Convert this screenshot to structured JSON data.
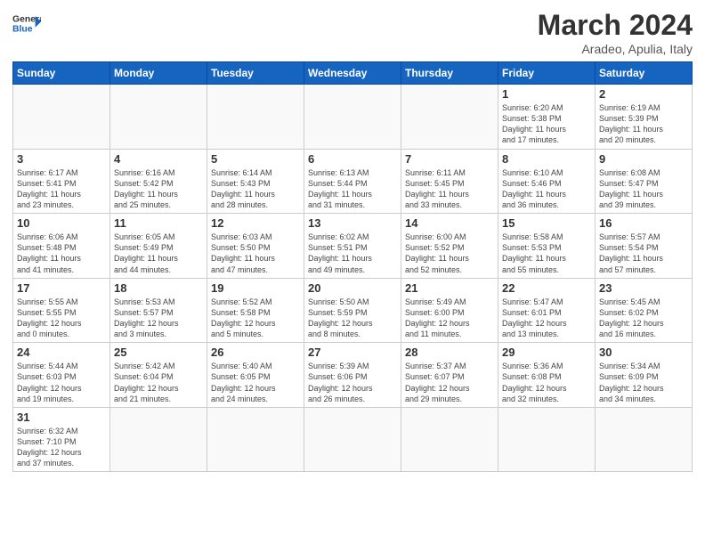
{
  "header": {
    "logo_general": "General",
    "logo_blue": "Blue",
    "title": "March 2024",
    "subtitle": "Aradeo, Apulia, Italy"
  },
  "days_of_week": [
    "Sunday",
    "Monday",
    "Tuesday",
    "Wednesday",
    "Thursday",
    "Friday",
    "Saturday"
  ],
  "weeks": [
    [
      {
        "day": "",
        "info": ""
      },
      {
        "day": "",
        "info": ""
      },
      {
        "day": "",
        "info": ""
      },
      {
        "day": "",
        "info": ""
      },
      {
        "day": "",
        "info": ""
      },
      {
        "day": "1",
        "info": "Sunrise: 6:20 AM\nSunset: 5:38 PM\nDaylight: 11 hours\nand 17 minutes."
      },
      {
        "day": "2",
        "info": "Sunrise: 6:19 AM\nSunset: 5:39 PM\nDaylight: 11 hours\nand 20 minutes."
      }
    ],
    [
      {
        "day": "3",
        "info": "Sunrise: 6:17 AM\nSunset: 5:41 PM\nDaylight: 11 hours\nand 23 minutes."
      },
      {
        "day": "4",
        "info": "Sunrise: 6:16 AM\nSunset: 5:42 PM\nDaylight: 11 hours\nand 25 minutes."
      },
      {
        "day": "5",
        "info": "Sunrise: 6:14 AM\nSunset: 5:43 PM\nDaylight: 11 hours\nand 28 minutes."
      },
      {
        "day": "6",
        "info": "Sunrise: 6:13 AM\nSunset: 5:44 PM\nDaylight: 11 hours\nand 31 minutes."
      },
      {
        "day": "7",
        "info": "Sunrise: 6:11 AM\nSunset: 5:45 PM\nDaylight: 11 hours\nand 33 minutes."
      },
      {
        "day": "8",
        "info": "Sunrise: 6:10 AM\nSunset: 5:46 PM\nDaylight: 11 hours\nand 36 minutes."
      },
      {
        "day": "9",
        "info": "Sunrise: 6:08 AM\nSunset: 5:47 PM\nDaylight: 11 hours\nand 39 minutes."
      }
    ],
    [
      {
        "day": "10",
        "info": "Sunrise: 6:06 AM\nSunset: 5:48 PM\nDaylight: 11 hours\nand 41 minutes."
      },
      {
        "day": "11",
        "info": "Sunrise: 6:05 AM\nSunset: 5:49 PM\nDaylight: 11 hours\nand 44 minutes."
      },
      {
        "day": "12",
        "info": "Sunrise: 6:03 AM\nSunset: 5:50 PM\nDaylight: 11 hours\nand 47 minutes."
      },
      {
        "day": "13",
        "info": "Sunrise: 6:02 AM\nSunset: 5:51 PM\nDaylight: 11 hours\nand 49 minutes."
      },
      {
        "day": "14",
        "info": "Sunrise: 6:00 AM\nSunset: 5:52 PM\nDaylight: 11 hours\nand 52 minutes."
      },
      {
        "day": "15",
        "info": "Sunrise: 5:58 AM\nSunset: 5:53 PM\nDaylight: 11 hours\nand 55 minutes."
      },
      {
        "day": "16",
        "info": "Sunrise: 5:57 AM\nSunset: 5:54 PM\nDaylight: 11 hours\nand 57 minutes."
      }
    ],
    [
      {
        "day": "17",
        "info": "Sunrise: 5:55 AM\nSunset: 5:55 PM\nDaylight: 12 hours\nand 0 minutes."
      },
      {
        "day": "18",
        "info": "Sunrise: 5:53 AM\nSunset: 5:57 PM\nDaylight: 12 hours\nand 3 minutes."
      },
      {
        "day": "19",
        "info": "Sunrise: 5:52 AM\nSunset: 5:58 PM\nDaylight: 12 hours\nand 5 minutes."
      },
      {
        "day": "20",
        "info": "Sunrise: 5:50 AM\nSunset: 5:59 PM\nDaylight: 12 hours\nand 8 minutes."
      },
      {
        "day": "21",
        "info": "Sunrise: 5:49 AM\nSunset: 6:00 PM\nDaylight: 12 hours\nand 11 minutes."
      },
      {
        "day": "22",
        "info": "Sunrise: 5:47 AM\nSunset: 6:01 PM\nDaylight: 12 hours\nand 13 minutes."
      },
      {
        "day": "23",
        "info": "Sunrise: 5:45 AM\nSunset: 6:02 PM\nDaylight: 12 hours\nand 16 minutes."
      }
    ],
    [
      {
        "day": "24",
        "info": "Sunrise: 5:44 AM\nSunset: 6:03 PM\nDaylight: 12 hours\nand 19 minutes."
      },
      {
        "day": "25",
        "info": "Sunrise: 5:42 AM\nSunset: 6:04 PM\nDaylight: 12 hours\nand 21 minutes."
      },
      {
        "day": "26",
        "info": "Sunrise: 5:40 AM\nSunset: 6:05 PM\nDaylight: 12 hours\nand 24 minutes."
      },
      {
        "day": "27",
        "info": "Sunrise: 5:39 AM\nSunset: 6:06 PM\nDaylight: 12 hours\nand 26 minutes."
      },
      {
        "day": "28",
        "info": "Sunrise: 5:37 AM\nSunset: 6:07 PM\nDaylight: 12 hours\nand 29 minutes."
      },
      {
        "day": "29",
        "info": "Sunrise: 5:36 AM\nSunset: 6:08 PM\nDaylight: 12 hours\nand 32 minutes."
      },
      {
        "day": "30",
        "info": "Sunrise: 5:34 AM\nSunset: 6:09 PM\nDaylight: 12 hours\nand 34 minutes."
      }
    ],
    [
      {
        "day": "31",
        "info": "Sunrise: 6:32 AM\nSunset: 7:10 PM\nDaylight: 12 hours\nand 37 minutes."
      },
      {
        "day": "",
        "info": ""
      },
      {
        "day": "",
        "info": ""
      },
      {
        "day": "",
        "info": ""
      },
      {
        "day": "",
        "info": ""
      },
      {
        "day": "",
        "info": ""
      },
      {
        "day": "",
        "info": ""
      }
    ]
  ]
}
